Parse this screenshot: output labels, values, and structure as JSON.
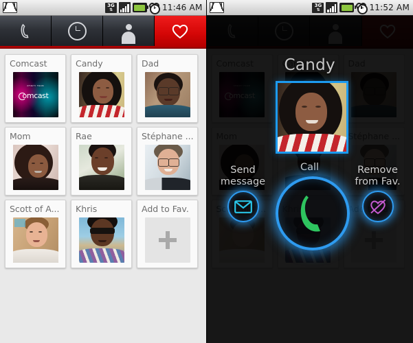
{
  "device": {
    "left": {
      "statusbar": {
        "notification_icon": "gmail-icon",
        "network": "3G",
        "network_arrows": "⇅",
        "signal_icon": "signal-bars-icon",
        "battery_icon": "battery-icon",
        "alarm_icon": "alarm-clock-icon",
        "time": "11:46 AM"
      },
      "tabs": [
        {
          "name": "tab-phone",
          "icon": "phone-handset-icon",
          "active": false
        },
        {
          "name": "tab-recent",
          "icon": "clock-icon",
          "active": false
        },
        {
          "name": "tab-contacts",
          "icon": "person-icon",
          "active": false
        },
        {
          "name": "tab-favorites",
          "icon": "heart-icon",
          "active": true
        }
      ],
      "favorites": [
        {
          "label": "Comcast",
          "thumb": "comcast-logo"
        },
        {
          "label": "Candy",
          "thumb": "photo-candy"
        },
        {
          "label": "Dad",
          "thumb": "photo-dad"
        },
        {
          "label": "Mom",
          "thumb": "photo-mom"
        },
        {
          "label": "Rae",
          "thumb": "photo-rae"
        },
        {
          "label": "Stéphane ...",
          "thumb": "photo-stephane"
        },
        {
          "label": "Scott of A...",
          "thumb": "photo-scott"
        },
        {
          "label": "Khris",
          "thumb": "photo-khris"
        },
        {
          "label": "Add to Fav.",
          "thumb": "plus-placeholder"
        }
      ]
    },
    "right": {
      "statusbar": {
        "notification_icon": "gmail-icon",
        "network": "3G",
        "network_arrows": "⇅",
        "signal_icon": "signal-bars-icon",
        "battery_icon": "battery-icon",
        "alarm_icon": "alarm-clock-icon",
        "time": "11:52 AM"
      },
      "overlay": {
        "contact_name": "Candy",
        "selected_photo": "photo-candy",
        "actions": [
          {
            "name": "send-message",
            "label": "Send message",
            "icon": "envelope-icon",
            "color": "#29c5e8"
          },
          {
            "name": "call",
            "label": "Call",
            "icon": "phone-handset-icon",
            "color": "#2ec45f"
          },
          {
            "name": "remove-from-favorites",
            "label": "Remove from Fav.",
            "icon": "heart-slash-icon",
            "color": "#c45ad0"
          }
        ]
      }
    }
  },
  "colors": {
    "accent_blue": "#2e9bf0",
    "tab_active_red": "#d40606",
    "call_green": "#2ec45f",
    "message_cyan": "#29c5e8",
    "remove_magenta": "#c45ad0",
    "grid_bg": "#e9e9e9"
  }
}
